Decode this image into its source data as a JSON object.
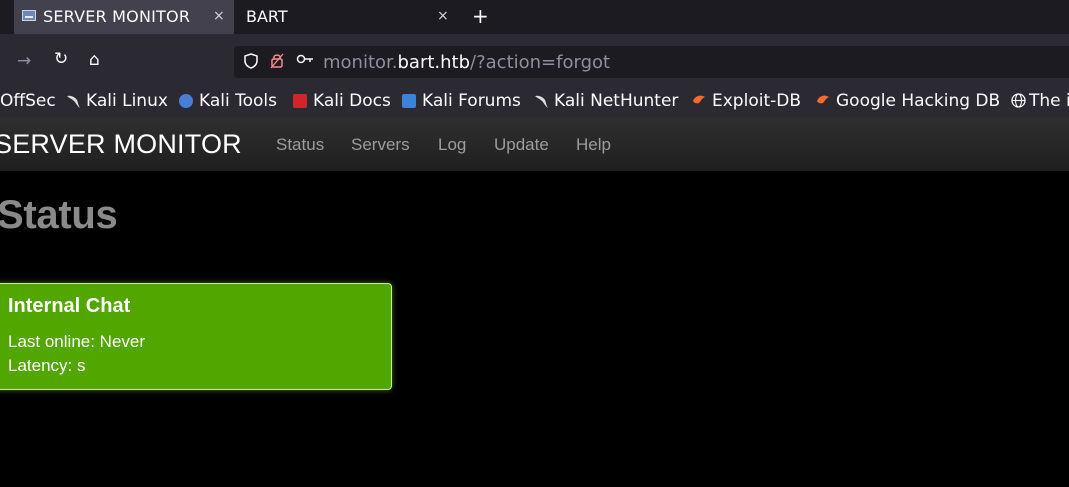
{
  "tabs": [
    {
      "title": "SERVER MONITOR",
      "active": true
    },
    {
      "title": "BART",
      "active": false
    }
  ],
  "tab_close_glyph": "×",
  "newtab_glyph": "+",
  "nav": {
    "back_icon": "→",
    "reload_icon": "↻",
    "home_icon": "⌂"
  },
  "url": {
    "prefix": "monitor.",
    "host": "bart.htb",
    "path": "/?action=forgot"
  },
  "bookmarks": [
    {
      "label": "OffSec",
      "icon": "none"
    },
    {
      "label": "Kali Linux",
      "icon": "dragon-icon"
    },
    {
      "label": "Kali Tools",
      "icon": "tools-icon"
    },
    {
      "label": "Kali Docs",
      "icon": "docs-icon"
    },
    {
      "label": "Kali Forums",
      "icon": "forums-icon"
    },
    {
      "label": "Kali NetHunter",
      "icon": "dragon-icon"
    },
    {
      "label": "Exploit-DB",
      "icon": "exploit-icon"
    },
    {
      "label": "Google Hacking DB",
      "icon": "exploit-icon"
    },
    {
      "label": "The i",
      "icon": "globe-icon"
    }
  ],
  "site": {
    "brand": "SERVER MONITOR",
    "nav_links": [
      "Status",
      "Servers",
      "Log",
      "Update",
      "Help"
    ],
    "page_title": "Status"
  },
  "server_card": {
    "name": "Internal Chat",
    "last_online": "Last online: Never",
    "latency": "Latency: s",
    "status_color": "#51a600"
  }
}
